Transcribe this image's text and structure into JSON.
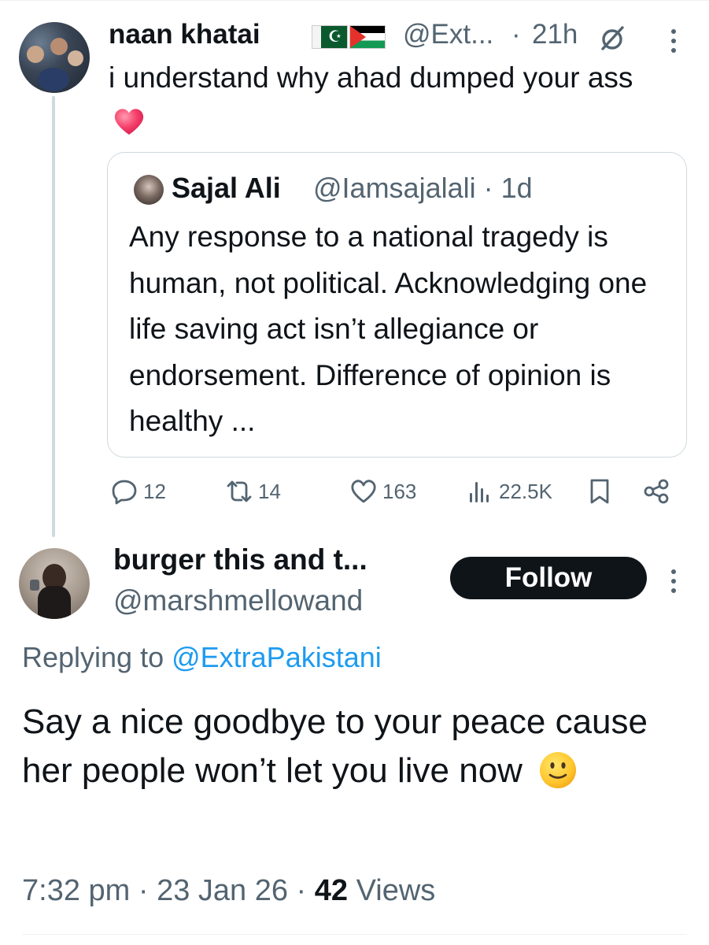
{
  "parent_tweet": {
    "display_name": "naan khatai",
    "flags": [
      "pakistan-flag",
      "palestine-flag"
    ],
    "handle": "@Ext...",
    "separator": "·",
    "time": "21h",
    "text": "i understand why ahad dumped your ass",
    "emoji": "heart-emoji"
  },
  "quoted_tweet": {
    "display_name": "Sajal Ali",
    "handle": "@Iamsajalali · 1d",
    "text": "Any response to a national tragedy is human, not political. Acknowledging one life saving act isn’t allegiance or endorsement. Difference of opinion is healthy ..."
  },
  "actions": {
    "replies": "12",
    "reposts": "14",
    "likes": "163",
    "views": "22.5K"
  },
  "reply_tweet": {
    "display_name": "burger this and t...",
    "handle": "@marshmellowand",
    "follow_label": "Follow",
    "replying_prefix": "Replying to ",
    "replying_to": "@ExtraPakistani",
    "text": "Say a nice goodbye to your peace cause her people won’t let you live now",
    "emoji": "slightly-smiling-face-emoji",
    "time_date": "7:32 pm · 23 Jan 26 · ",
    "views_count": "42",
    "views_label": " Views"
  },
  "colors": {
    "text": "#0f1419",
    "secondary": "#536471",
    "link": "#1d9bf0",
    "border": "#cfd9de"
  }
}
